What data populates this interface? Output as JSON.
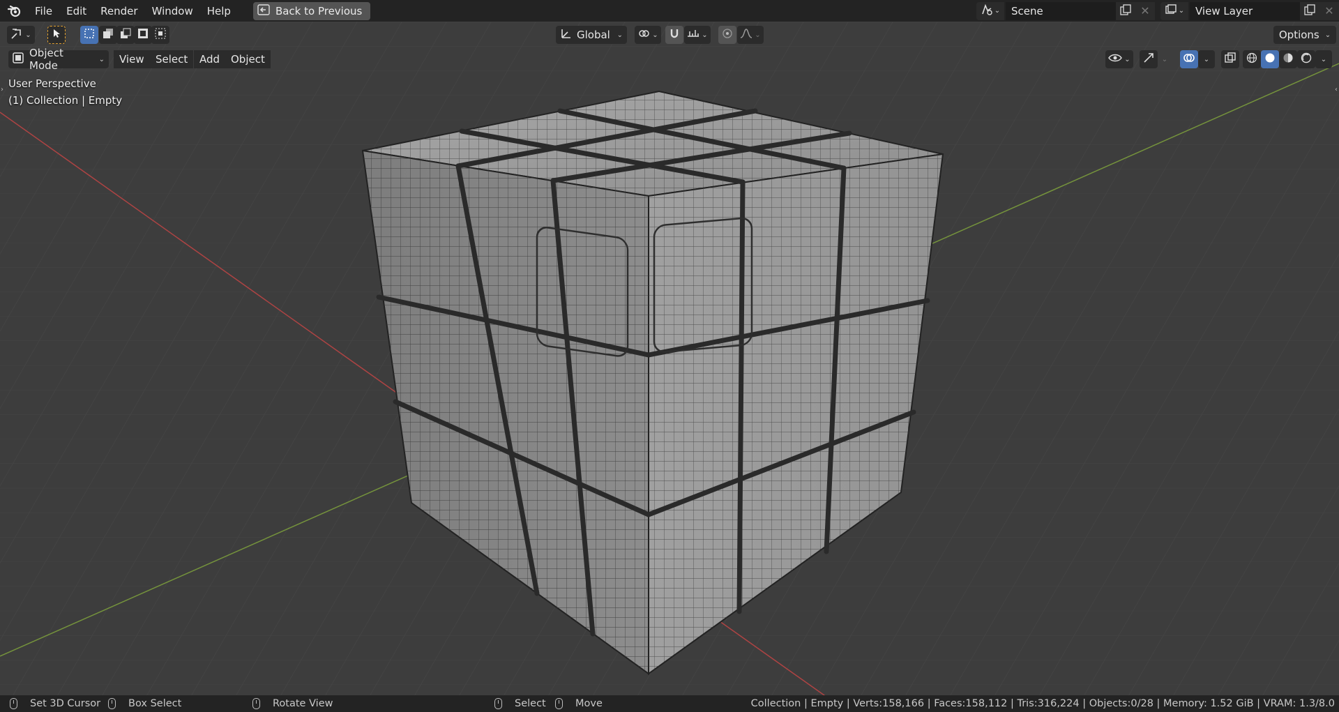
{
  "menu": {
    "items": [
      "File",
      "Edit",
      "Render",
      "Window",
      "Help"
    ],
    "back_button": "Back to Previous"
  },
  "scene": {
    "name": "Scene"
  },
  "view_layer": {
    "name": "View Layer"
  },
  "tool_header": {
    "transform_orientation": "Global",
    "options_label": "Options"
  },
  "viewport_header": {
    "mode": "Object Mode",
    "menus": [
      "View",
      "Select",
      "Add",
      "Object"
    ]
  },
  "viewport": {
    "perspective_label": "User Perspective",
    "collection_label": "(1) Collection | Empty"
  },
  "statusbar": {
    "hints": [
      "Set 3D Cursor",
      "Box Select",
      "Rotate View",
      "Select",
      "Move"
    ],
    "stats": "Collection | Empty | Verts:158,166 | Faces:158,112 | Tris:316,224 | Objects:0/28 | Memory: 1.52 GiB | VRAM: 1.3/8.0"
  },
  "colors": {
    "accent_blue": "#4772b3",
    "axis_x": "#d24a4a",
    "axis_y": "#7fa33c",
    "viewport_bg": "#3d3d3d",
    "header_bg": "#232323"
  }
}
